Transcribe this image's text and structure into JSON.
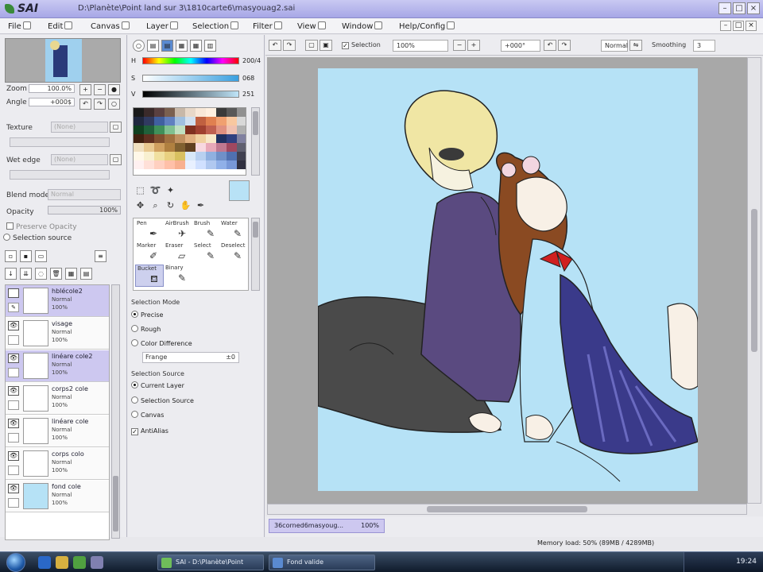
{
  "window": {
    "app_logo": "SAI",
    "title": "D:\\Planète\\Point land sur 3\\1810carte6\\masyouag2.sai"
  },
  "menu": [
    "File",
    "Edit",
    "Canvas",
    "Layer",
    "Selection",
    "Filter",
    "View",
    "Window",
    "Help/Config"
  ],
  "navigator": {
    "zoom_label": "Zoom",
    "zoom_value": "100.0%",
    "angle_label": "Angle",
    "angle_value": "+000$"
  },
  "layer_panel": {
    "texture_label": "Texture",
    "texture_value": "(None)",
    "wet_edge_label": "Wet edge",
    "wet_edge_value": "(None)",
    "blend_mode_label": "Blend mode",
    "blend_mode_value": "Normal",
    "opacity_label": "Opacity",
    "opacity_value": "100%",
    "preserve_opacity": "Preserve Opacity",
    "clip_group": "Clipping Group",
    "selection_source": "Selection source",
    "layers": [
      {
        "name": "hblécole2",
        "mode": "Normal",
        "opacity": "100%",
        "selected": true
      },
      {
        "name": "visage",
        "mode": "Normal",
        "opacity": "100%",
        "selected": false
      },
      {
        "name": "linéare cole2",
        "mode": "Normal",
        "opacity": "100%",
        "selected": true
      },
      {
        "name": "corps2 cole",
        "mode": "Normal",
        "opacity": "100%",
        "selected": false
      },
      {
        "name": "linéare cole",
        "mode": "Normal",
        "opacity": "100%",
        "selected": false
      },
      {
        "name": "corps colo",
        "mode": "Normal",
        "opacity": "100%",
        "selected": false
      },
      {
        "name": "fond cole",
        "mode": "Normal",
        "opacity": "100%",
        "selected": false
      }
    ]
  },
  "color": {
    "h_label": "H",
    "h_value": "200/4",
    "s_label": "S",
    "s_value": "068",
    "v_label": "V",
    "v_value": "251",
    "primary": "#b8e2f6"
  },
  "swatches": [
    "#1a1a1a",
    "#3a2a2a",
    "#5a4040",
    "#7a6050",
    "#c8b8a8",
    "#e8d8c8",
    "#f8e8d8",
    "#fff0e0",
    "#3a3a3a",
    "#585858",
    "#909090",
    "#202840",
    "#303a60",
    "#4060a0",
    "#6080c0",
    "#a0c0e0",
    "#d0e0f0",
    "#c06040",
    "#e08050",
    "#f0a070",
    "#f8c8a0",
    "#d8d8d8",
    "#104020",
    "#20603a",
    "#40905a",
    "#80c090",
    "#c0e0c0",
    "#803020",
    "#a04030",
    "#c06050",
    "#e09080",
    "#f0c0b0",
    "#b0b0b0",
    "#402010",
    "#603020",
    "#805030",
    "#a07040",
    "#c09060",
    "#e0b080",
    "#f0d0a0",
    "#f8e8c8",
    "#203060",
    "#304080",
    "#8080a0",
    "#f0e0c0",
    "#e8c890",
    "#d0a060",
    "#b08040",
    "#806030",
    "#604020",
    "#f8d8e0",
    "#e8a8b8",
    "#c07890",
    "#a04860",
    "#606070",
    "#fff8e8",
    "#f8f0d0",
    "#f0e0a0",
    "#e8d080",
    "#d8c060",
    "#d8e8f8",
    "#b8d0f0",
    "#90b0e0",
    "#7090c8",
    "#5070b0",
    "#404050",
    "#fff0f0",
    "#ffe0d8",
    "#ffd0c0",
    "#ffc0a8",
    "#f8b090",
    "#e8f0ff",
    "#d0e0ff",
    "#b0c8f0",
    "#90b0e8",
    "#7898d8",
    "#303040"
  ],
  "brushes": [
    {
      "name": "Pen",
      "selected": false
    },
    {
      "name": "AirBrush",
      "selected": false
    },
    {
      "name": "Brush",
      "selected": false
    },
    {
      "name": "Water",
      "selected": false
    },
    {
      "name": "Marker",
      "selected": false
    },
    {
      "name": "Eraser",
      "selected": false
    },
    {
      "name": "Select",
      "selected": false
    },
    {
      "name": "Deselect",
      "selected": false
    },
    {
      "name": "Bucket",
      "selected": true
    },
    {
      "name": "Binary",
      "selected": false
    }
  ],
  "tool_options": {
    "mode_label": "Selection Mode",
    "mode_options": [
      {
        "label": "Precise",
        "checked": true
      },
      {
        "label": "Rough",
        "checked": false
      },
      {
        "label": "Color Difference",
        "checked": false
      }
    ],
    "diff_value": "Frange",
    "diff_number": "±0",
    "source_label": "Selection Source",
    "source_options": [
      {
        "label": "Current Layer",
        "checked": true
      },
      {
        "label": "Selection Source",
        "checked": false
      },
      {
        "label": "Canvas",
        "checked": false
      }
    ],
    "antialias_label": "AntiAlias",
    "antialias_checked": true
  },
  "canvas_toolbar": {
    "selection_label": "Selection",
    "zoom_value": "100%",
    "angle_value": "+000°",
    "mode_value": "Normal",
    "stabilizer_label": "Smoothing",
    "stabilizer_value": "3"
  },
  "document_tab": {
    "label": "36corned6masyoug...",
    "zoom": "100%"
  },
  "status": {
    "memory": "Memory load: 50% (89MB / 4289MB)"
  },
  "taskbar": {
    "items": [
      {
        "label": "SAI - D:\\Planète\\Point"
      },
      {
        "label": "Fond valide"
      }
    ],
    "clock": "19:24"
  }
}
